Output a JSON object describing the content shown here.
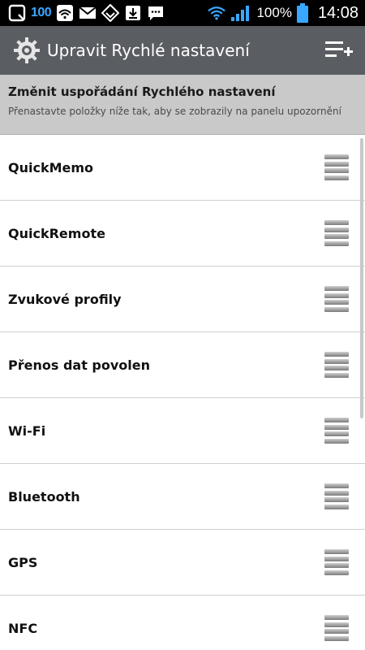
{
  "status_bar": {
    "notification_count": "100",
    "battery_percent": "100%",
    "clock": "14:08",
    "icons": [
      "q-app-icon",
      "wifi-signal-icon",
      "gmail-icon",
      "feedly-icon",
      "download-icon",
      "messaging-icon",
      "wifi-icon",
      "cell-signal-icon",
      "battery-icon"
    ]
  },
  "action_bar": {
    "title": "Upravit Rychlé nastavení",
    "icons": [
      "gear-icon",
      "add-list-icon"
    ]
  },
  "header": {
    "title": "Změnit uspořádání Rychlého nastavení",
    "subtitle": "Přenastavte položky níže tak, aby se zobrazily na panelu upozornění"
  },
  "items": [
    {
      "label": "QuickMemo"
    },
    {
      "label": "QuickRemote"
    },
    {
      "label": "Zvukové profily"
    },
    {
      "label": "Přenos dat povolen"
    },
    {
      "label": "Wi-Fi"
    },
    {
      "label": "Bluetooth"
    },
    {
      "label": "GPS"
    },
    {
      "label": "NFC"
    }
  ],
  "colors": {
    "action_bar": "#5a5d61",
    "header_strip": "#c9c9c9",
    "status_accent": "#3aa7ff"
  }
}
